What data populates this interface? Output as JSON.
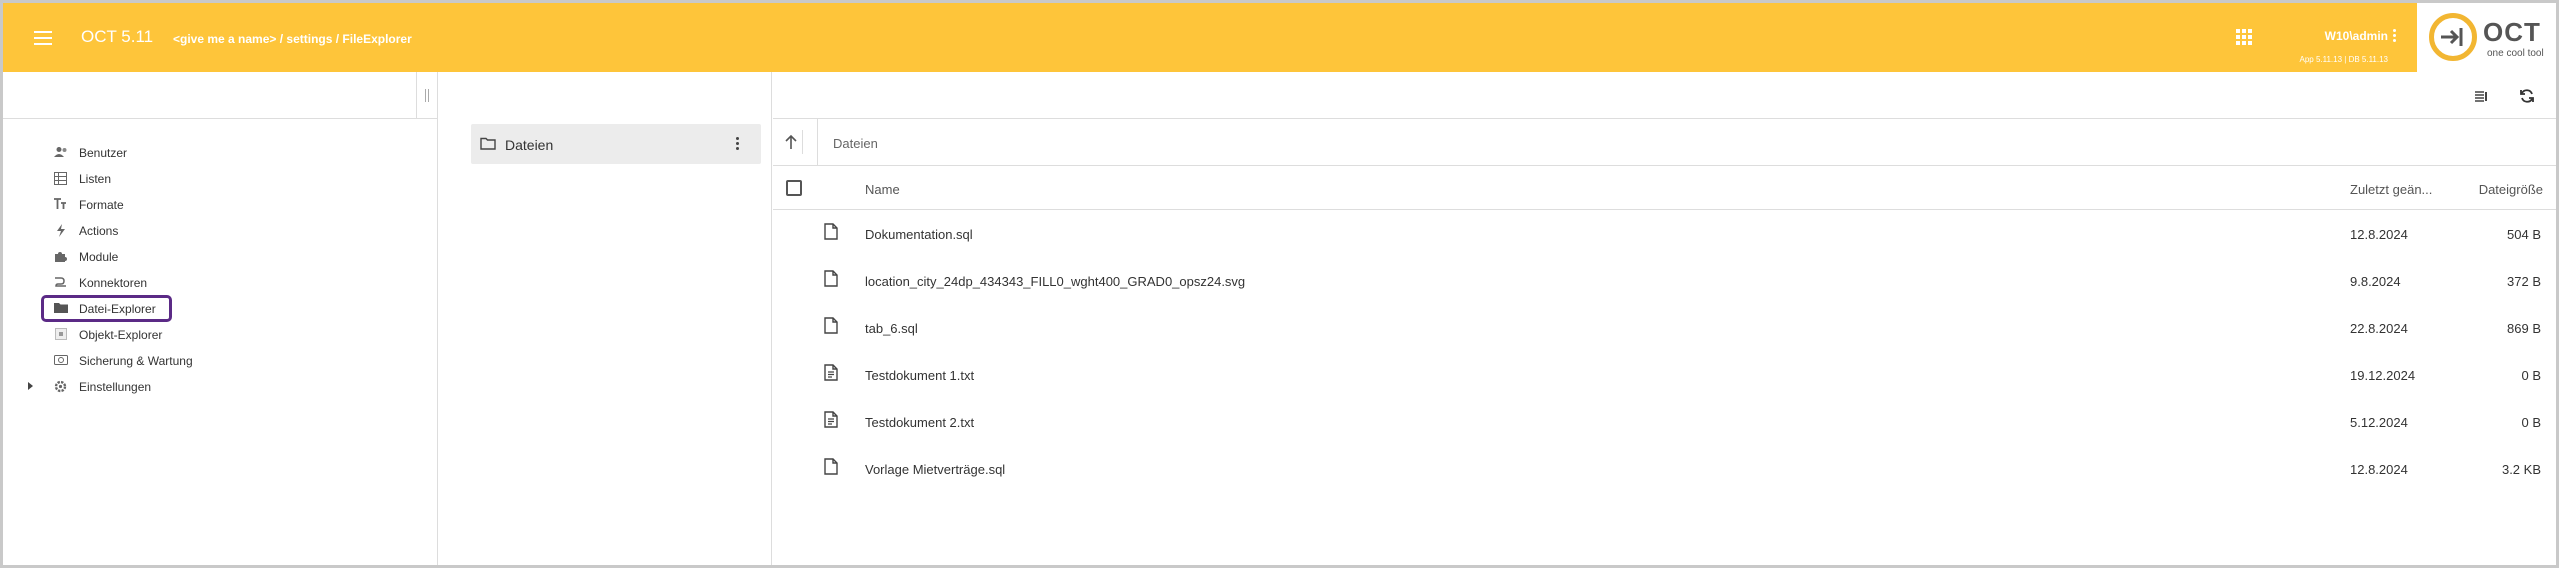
{
  "header": {
    "app_title": "OCT 5.11",
    "breadcrumb": "<give me a name> / settings / FileExplorer",
    "user": "W10\\admin",
    "version": "App 5.11.13 | DB 5.11.13",
    "logo_text": "OCT",
    "logo_sub": "one cool tool",
    "accent_color": "#fec53a"
  },
  "sidebar": {
    "items": [
      {
        "label": "Benutzer",
        "icon": "users-icon"
      },
      {
        "label": "Listen",
        "icon": "table-icon"
      },
      {
        "label": "Formate",
        "icon": "text-format-icon"
      },
      {
        "label": "Actions",
        "icon": "bolt-icon"
      },
      {
        "label": "Module",
        "icon": "puzzle-icon"
      },
      {
        "label": "Konnektoren",
        "icon": "connector-icon"
      },
      {
        "label": "Datei-Explorer",
        "icon": "folder-icon",
        "active": true
      },
      {
        "label": "Objekt-Explorer",
        "icon": "object-icon"
      },
      {
        "label": "Sicherung & Wartung",
        "icon": "backup-icon"
      },
      {
        "label": "Einstellungen",
        "icon": "gear-icon",
        "expandable": true
      }
    ]
  },
  "folders": {
    "items": [
      {
        "label": "Dateien",
        "icon": "folder-icon"
      }
    ]
  },
  "main": {
    "path": "Dateien",
    "columns": {
      "name": "Name",
      "date": "Zuletzt geän...",
      "size": "Dateigröße"
    },
    "files": [
      {
        "name": "Dokumentation.sql",
        "date": "12.8.2024",
        "size": "504 B",
        "icon": "file-icon"
      },
      {
        "name": "location_city_24dp_434343_FILL0_wght400_GRAD0_opsz24.svg",
        "date": "9.8.2024",
        "size": "372 B",
        "icon": "file-icon"
      },
      {
        "name": "tab_6.sql",
        "date": "22.8.2024",
        "size": "869 B",
        "icon": "file-icon"
      },
      {
        "name": "Testdokument 1.txt",
        "date": "19.12.2024",
        "size": "0 B",
        "icon": "text-file-icon"
      },
      {
        "name": "Testdokument 2.txt",
        "date": "5.12.2024",
        "size": "0 B",
        "icon": "text-file-icon"
      },
      {
        "name": "Vorlage Mietverträge.sql",
        "date": "12.8.2024",
        "size": "3.2 KB",
        "icon": "file-icon"
      }
    ]
  }
}
